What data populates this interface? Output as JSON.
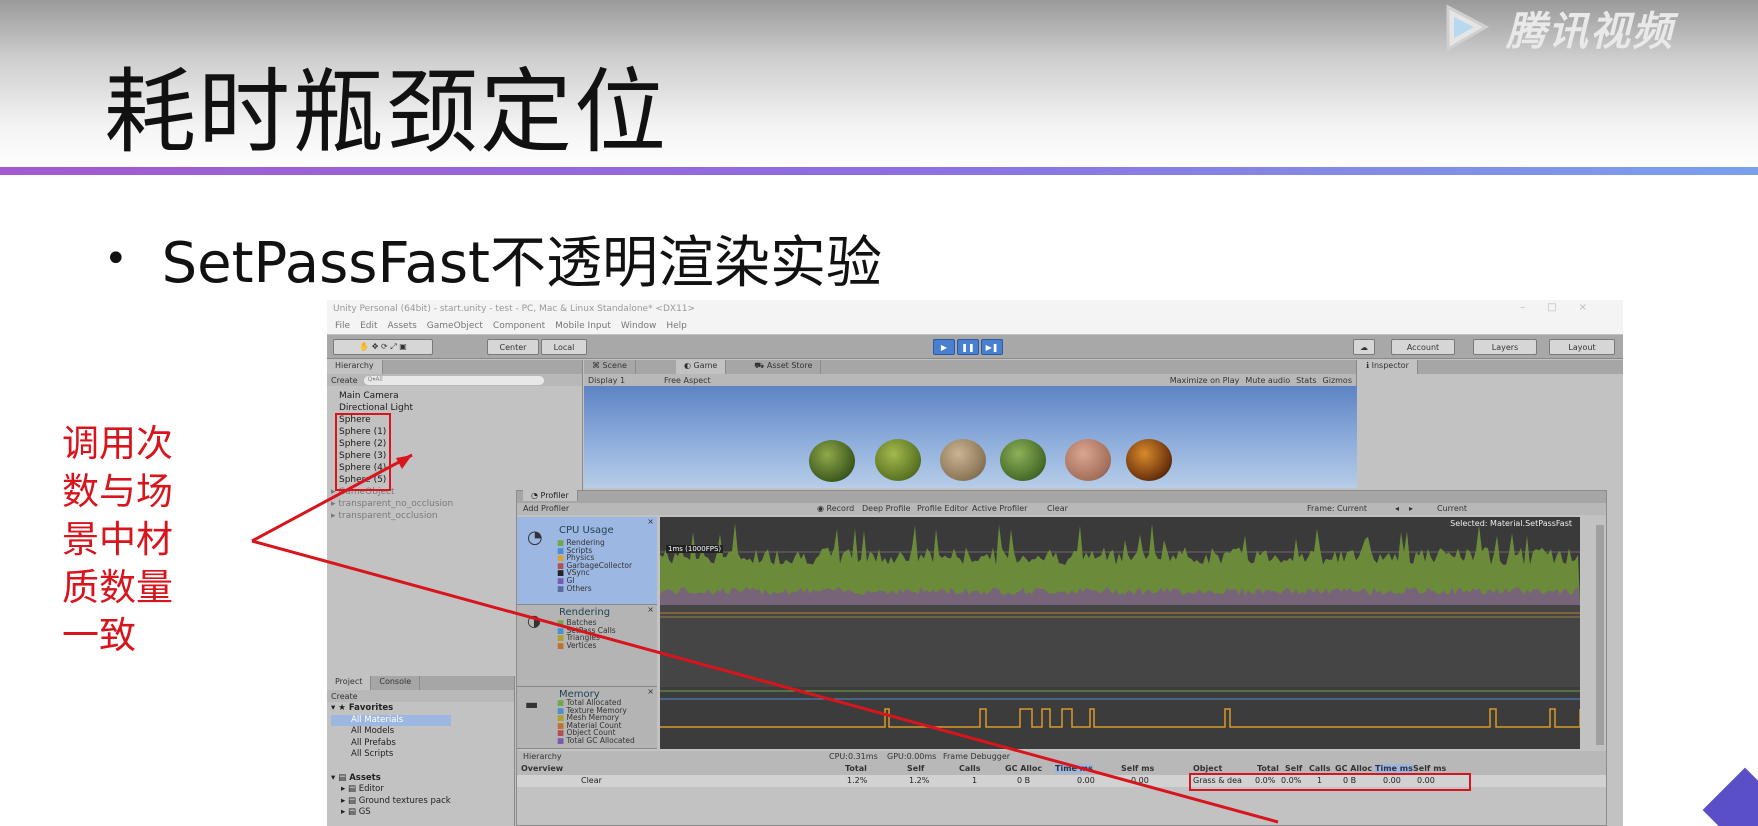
{
  "slide": {
    "title": "耗时瓶颈定位",
    "bullet": "SetPassFast不透明渲染实验",
    "bullet_symbol": "•",
    "note": [
      "调用次",
      "数与场",
      "景中材",
      "质数量",
      "一致"
    ],
    "logo_text": "腾讯视频",
    "colors": {
      "note": "#d8141c",
      "rule": "#a35ad1"
    }
  },
  "unity": {
    "window_title": "Unity Personal (64bit) - start.unity - test - PC, Mac & Linux Standalone* <DX11>",
    "menu": [
      "File",
      "Edit",
      "Assets",
      "GameObject",
      "Component",
      "Mobile Input",
      "Window",
      "Help"
    ],
    "toolbar": {
      "center": "Center",
      "local": "Local",
      "account": "Account",
      "layers": "Layers",
      "layout": "Layout"
    },
    "hierarchy": {
      "tab": "Hierarchy",
      "create": "Create",
      "search_placeholder": "Q▾All",
      "items": [
        "Main Camera",
        "Directional Light",
        "Sphere",
        "Sphere (1)",
        "Sphere (2)",
        "Sphere (3)",
        "Sphere (4)",
        "Sphere (5)"
      ],
      "dim_items": [
        "GameObject",
        "transparent_no_occlusion",
        "transparent_occlusion"
      ]
    },
    "scene_tabs": {
      "scene": "Scene",
      "game": "Game",
      "asset_store": "Asset Store"
    },
    "game_bar": {
      "display": "Display 1",
      "aspect": "Free Aspect",
      "maximize": "Maximize on Play",
      "mute": "Mute audio",
      "stats": "Stats",
      "gizmos": "Gizmos"
    },
    "inspector_tab": "Inspector",
    "project": {
      "tab": "Project",
      "console_tab": "Console",
      "create": "Create",
      "favorites": "Favorites",
      "fav_items": [
        "All Materials",
        "All Models",
        "All Prefabs",
        "All Scripts"
      ],
      "assets": "Assets",
      "asset_items": [
        "Editor",
        "Ground textures pack",
        "GS"
      ]
    },
    "profiler": {
      "tab": "Profiler",
      "add": "Add Profiler",
      "bar": [
        "Record",
        "Deep Profile",
        "Profile Editor",
        "Active Profiler",
        "Clear"
      ],
      "frame_label": "Frame:",
      "frame_value": "Current",
      "current_btn": "Current",
      "selected": "Selected: Material.SetPassFast",
      "graph_label": "1ms (1000FPS)",
      "modules": [
        {
          "title": "CPU Usage",
          "legend": [
            "Rendering",
            "Scripts",
            "Physics",
            "GarbageCollector",
            "VSync",
            "GI",
            "Others"
          ]
        },
        {
          "title": "Rendering",
          "legend": [
            "Batches",
            "SetPass Calls",
            "Triangles",
            "Vertices"
          ]
        },
        {
          "title": "Memory",
          "legend": [
            "Total Allocated",
            "Texture Memory",
            "Mesh Memory",
            "Material Count",
            "Object Count",
            "Total GC Allocated"
          ]
        }
      ],
      "status": {
        "mode": "Hierarchy",
        "cpu": "CPU:0.31ms",
        "gpu": "GPU:0.00ms",
        "frame_debugger": "Frame Debugger"
      },
      "columns": [
        "Overview",
        "Total",
        "Self",
        "Calls",
        "GC Alloc",
        "Time ms",
        "Self ms"
      ],
      "row": {
        "name": "Clear",
        "total": "1.2%",
        "self": "1.2%",
        "calls": "1",
        "gc": "0 B",
        "time": "0.00",
        "selfms": "0.00"
      },
      "object_columns": [
        "Object",
        "Total",
        "Self",
        "Calls",
        "GC Alloc",
        "Time ms",
        "Self ms"
      ],
      "object_rows": [
        {
          "name": "Grass & dea",
          "total": "0.0%",
          "self": "0.0%",
          "calls": "1",
          "gc": "0 B",
          "time": "0.00",
          "selfms": "0.00"
        }
      ]
    }
  }
}
